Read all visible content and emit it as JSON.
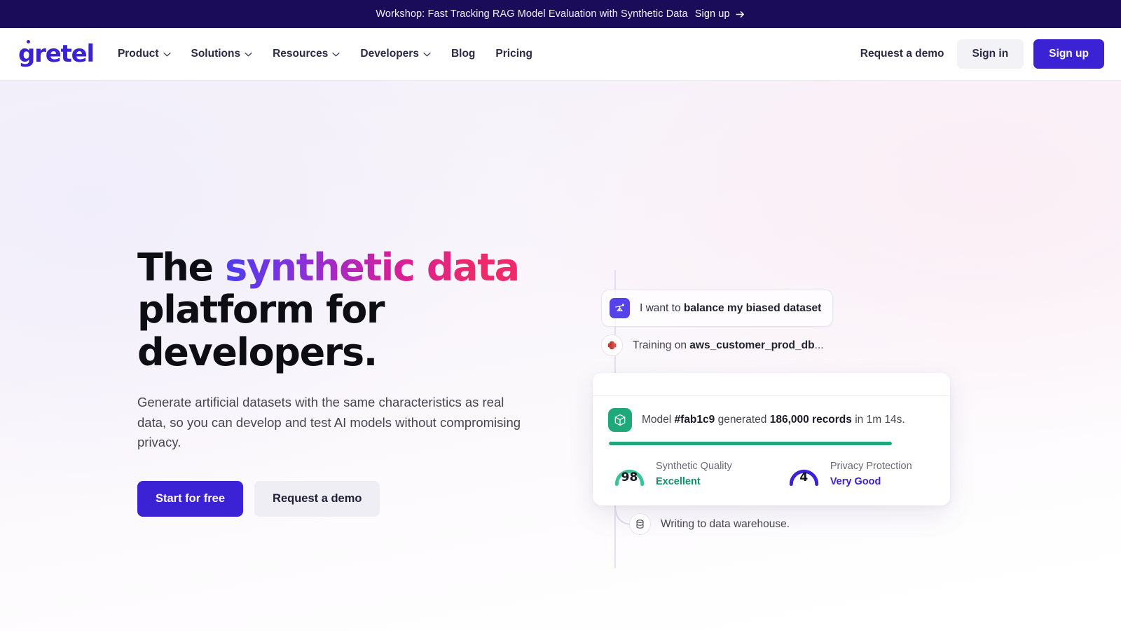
{
  "announcement": {
    "message": "Workshop: Fast Tracking RAG Model Evaluation with Synthetic Data",
    "cta_label": "Sign up",
    "arrow_icon": "arrow-right-icon",
    "background": "#1b0c5a"
  },
  "header": {
    "logo_text": "gretel",
    "logo_color": "#3b22d4",
    "nav": [
      {
        "label": "Product",
        "has_dropdown": true,
        "icon": "chevron-down-icon"
      },
      {
        "label": "Solutions",
        "has_dropdown": true,
        "icon": "chevron-down-icon"
      },
      {
        "label": "Resources",
        "has_dropdown": true,
        "icon": "chevron-down-icon"
      },
      {
        "label": "Developers",
        "has_dropdown": true,
        "icon": "chevron-down-icon"
      },
      {
        "label": "Blog",
        "has_dropdown": false
      },
      {
        "label": "Pricing",
        "has_dropdown": false
      }
    ],
    "request_demo_label": "Request a demo",
    "sign_in_label": "Sign in",
    "sign_up_label": "Sign up",
    "sign_up_color": "#3b22d4"
  },
  "hero": {
    "headline_part1": "The ",
    "headline_gradient": "synthetic data",
    "headline_part2": "platform for developers.",
    "subhead": "Generate artificial datasets with the same characteristics as real data, so you can develop and test AI models without compromising privacy.",
    "primary_button": "Start for free",
    "secondary_button": "Request a demo",
    "gradient_start": "#4b3cf0",
    "gradient_end": "#ef2a6a"
  },
  "illustration": {
    "prompt_pill": {
      "icon": "balance-scale-icon",
      "icon_bg": "#5542e8",
      "text_prefix": "I want to ",
      "text_bold": "balance my biased dataset"
    },
    "training_row": {
      "icon": "redshift-database-icon",
      "text_prefix": "Training on ",
      "text_bold": "aws_customer_prod_db",
      "text_suffix": "..."
    },
    "result_card": {
      "icon": "cube-model-icon",
      "icon_bg": "#1fa97a",
      "message_prefix": "Model ",
      "model_id": "#fab1c9",
      "message_mid": " generated ",
      "record_count": "186,000 records",
      "message_suffix": " in 1m 14s.",
      "progress_percent": 100,
      "progress_color": "#1fa97a",
      "metrics": [
        {
          "value": "98",
          "label": "Synthetic Quality",
          "status": "Excellent",
          "color": "#10916a",
          "arc_percent": 92
        },
        {
          "value": "4",
          "label": "Privacy Protection",
          "status": "Very Good",
          "color": "#3b22d4",
          "arc_percent": 80
        }
      ]
    },
    "write_row": {
      "icon": "database-cylinder-icon",
      "text": "Writing to data warehouse."
    }
  }
}
